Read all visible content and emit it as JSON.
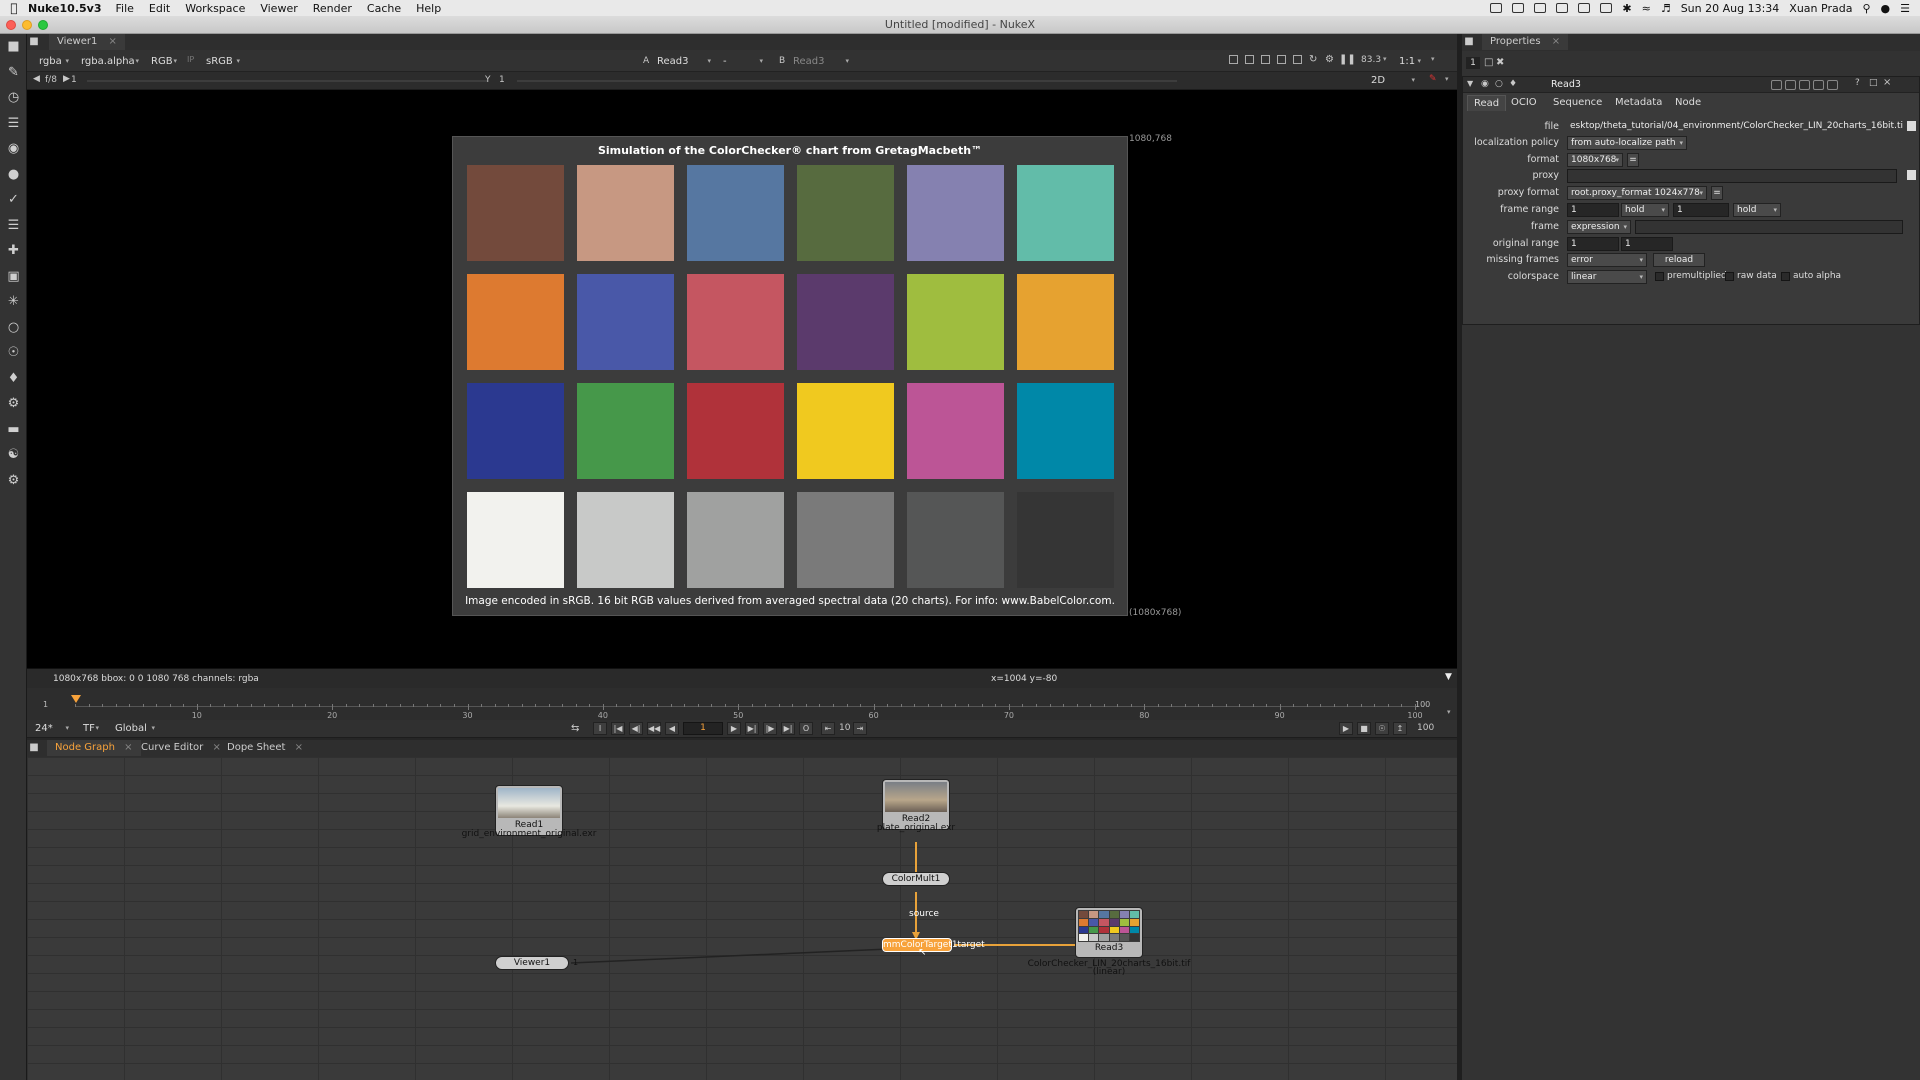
{
  "menubar": {
    "app_name": "Nuke10.5v3",
    "items": [
      "File",
      "Edit",
      "Workspace",
      "Viewer",
      "Render",
      "Cache",
      "Help"
    ],
    "clock": "Sun 20 Aug  13:34",
    "user": "Xuan Prada"
  },
  "window": {
    "title": "Untitled [modified] - NukeX"
  },
  "viewer": {
    "tab": "Viewer1",
    "channels": "rgba",
    "alpha_channel": "rgba.alpha",
    "display": "RGB",
    "lut": "sRGB",
    "input_a_label": "A",
    "input_a": "Read3",
    "operation": "-",
    "input_b_label": "B",
    "input_b": "Read3",
    "gain": "83.3",
    "zoom": "1:1",
    "frame_fraction": "f/8",
    "frame_field": "1",
    "y_label": "Y",
    "y_field": "1",
    "view_mode": "2D",
    "format_corner_top": "1080,768",
    "format_corner_bottom": "(1080x768)",
    "status_left": "1080x768  bbox: 0 0 1080 768 channels: rgba",
    "status_center": "x=1004 y=-80"
  },
  "chart": {
    "title": "Simulation of the ColorChecker® chart from GretagMacbeth™",
    "caption": "Image encoded in sRGB. 16 bit RGB values derived from averaged spectral data (20 charts). For info: www.BabelColor.com.",
    "swatches": [
      [
        "#734a3c",
        "#c79882",
        "#5677a1",
        "#576b3f",
        "#8581b0",
        "#62bca9"
      ],
      [
        "#dd7a30",
        "#4958a8",
        "#c55661",
        "#5b3a6c",
        "#9fbd3f",
        "#e6a230"
      ],
      [
        "#2b3990",
        "#46984a",
        "#b0323a",
        "#f0c91f",
        "#bc5596",
        "#0088a8"
      ],
      [
        "#f2f2ee",
        "#c8c9c8",
        "#a0a1a0",
        "#7a7a7a",
        "#555656",
        "#353535"
      ]
    ]
  },
  "timeline": {
    "start": "1",
    "end": "100",
    "ticks": [
      "10",
      "20",
      "30",
      "40",
      "50",
      "60",
      "70",
      "80",
      "90",
      "100"
    ],
    "fps": "24*",
    "tf": "TF",
    "scope": "Global",
    "current_frame": "1",
    "increment": "10",
    "end_field": "100"
  },
  "panels": {
    "node_graph": "Node Graph",
    "curve_editor": "Curve Editor",
    "dope_sheet": "Dope Sheet",
    "properties": "Properties"
  },
  "nodes": {
    "read1": {
      "name": "Read1",
      "file": "grid_environment_original.exr"
    },
    "read2": {
      "name": "Read2",
      "file": "plate_original.exr"
    },
    "colormult": {
      "name": "ColorMult1"
    },
    "colormatch": {
      "name": "mmColorTarget1",
      "source_label": "source",
      "target_label": "target"
    },
    "read3": {
      "name": "Read3",
      "file": "ColorChecker_LIN_20charts_16bit.tif",
      "colorspace": "(linear)"
    },
    "viewer1": {
      "name": "Viewer1"
    }
  },
  "properties": {
    "counter": "1",
    "node_name": "Read3",
    "tabs": [
      "Read",
      "OCIO",
      "Sequence",
      "Metadata",
      "Node"
    ],
    "file_label": "file",
    "file_value": "esktop/theta_tutorial/04_environment/ColorChecker_LIN_20charts_16bit.tif",
    "localization_label": "localization policy",
    "localization_value": "from auto-localize path",
    "format_label": "format",
    "format_value": "1080x768",
    "proxy_label": "proxy",
    "proxy_format_label": "proxy format",
    "proxy_format_value": "root.proxy_format 1024x778",
    "frame_range_label": "frame range",
    "frame_range_start": "1",
    "frame_range_before": "hold",
    "frame_range_end": "1",
    "frame_range_after": "hold",
    "frame_label": "frame",
    "frame_value": "expression",
    "original_range_label": "original range",
    "original_range_start": "1",
    "original_range_end": "1",
    "missing_frames_label": "missing frames",
    "missing_frames_value": "error",
    "reload_label": "reload",
    "colorspace_label": "colorspace",
    "colorspace_value": "linear",
    "premultiplied_label": "premultiplied",
    "raw_data_label": "raw data",
    "auto_alpha_label": "auto alpha"
  },
  "colors": {
    "highlight_orange": "#f7a23b",
    "pipe_orange": "#e8a23a"
  }
}
